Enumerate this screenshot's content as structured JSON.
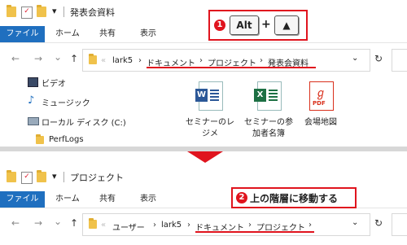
{
  "top": {
    "title": "発表会資料",
    "qa_dropdown": "▾",
    "tabs": {
      "file": "ファイル",
      "home": "ホーム",
      "share": "共有",
      "view": "表示"
    },
    "nav": {
      "back": "←",
      "forward": "→",
      "recent": "⌄",
      "up": "↑"
    },
    "breadcrumb": [
      "lark5",
      "ドキュメント",
      "プロジェクト",
      "発表会資料"
    ],
    "address_dropdown": "⌄",
    "refresh": "↻",
    "callout": {
      "number": "1",
      "key1": "Alt",
      "plus": "+",
      "key2": "🡅"
    },
    "sidebar": [
      {
        "icon": "video-icon",
        "label": "ビデオ"
      },
      {
        "icon": "music-icon",
        "label": "ミュージック"
      },
      {
        "icon": "drive-icon",
        "label": "ローカル ディスク (C:)"
      },
      {
        "icon": "folder-icon",
        "label": "PerfLogs"
      }
    ],
    "files": [
      {
        "icon": "word-document-icon",
        "badge": "W",
        "label_l1": "セミナーのレ",
        "label_l2": "ジメ",
        "color": "#2b5797"
      },
      {
        "icon": "excel-document-icon",
        "badge": "X",
        "label_l1": "セミナーの参",
        "label_l2": "加者名簿",
        "color": "#1d7044"
      },
      {
        "icon": "pdf-document-icon",
        "badge": "PDF",
        "label_l1": "会場地図",
        "label_l2": "",
        "color": "#d9301c"
      }
    ]
  },
  "bottom": {
    "title": "プロジェクト",
    "qa_dropdown": "▾",
    "tabs": {
      "file": "ファイル",
      "home": "ホーム",
      "share": "共有",
      "view": "表示"
    },
    "nav": {
      "back": "←",
      "forward": "→",
      "recent": "⌄",
      "up": "↑"
    },
    "breadcrumb": [
      "ユーザー",
      "lark5",
      "ドキュメント",
      "プロジェクト"
    ],
    "address_dropdown": "⌄",
    "refresh": "↻",
    "callout": {
      "number": "2",
      "text": "上の階層に移動する"
    }
  },
  "colors": {
    "accent": "#e0141e",
    "ribbon_file": "#1f6fbf"
  }
}
